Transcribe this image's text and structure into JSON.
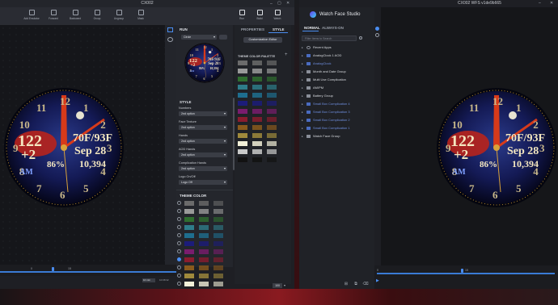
{
  "left_window": {
    "title": "CX002",
    "toolbar": [
      {
        "label": "Add Emulator",
        "icon": "emulator-icon"
      },
      {
        "label": "Forward",
        "icon": "forward-icon"
      },
      {
        "label": "Backward",
        "icon": "backward-icon"
      },
      {
        "label": "Group",
        "icon": "group-icon"
      },
      {
        "label": "Ungroup",
        "icon": "ungroup-icon"
      },
      {
        "label": "Mask",
        "icon": "mask-icon"
      }
    ],
    "toolbar_right": [
      {
        "label": "Run",
        "icon": "run-icon"
      },
      {
        "label": "Build",
        "icon": "build-icon"
      },
      {
        "label": "Watch",
        "icon": "watch-icon"
      }
    ],
    "run_panel": {
      "header": "RUN",
      "shape_value": "Circle",
      "style_header": "STYLE",
      "style_fields": [
        {
          "label": "Numbers",
          "value": "2nd option"
        },
        {
          "label": "Face Texture",
          "value": "2nd option"
        },
        {
          "label": "Hands",
          "value": "2nd option"
        },
        {
          "label": "AOD Hands",
          "value": "2nd option"
        },
        {
          "label": "Complication Hands",
          "value": "2nd option"
        },
        {
          "label": "Logo On/Off",
          "value": "Logo Off"
        }
      ],
      "theme_color_header": "THEME COLOR",
      "selected_theme_index": 7
    },
    "properties_panel": {
      "tabs": [
        "PROPERTIES",
        "STYLE"
      ],
      "active_tab": "STYLE",
      "customization_button": "Customization Editor",
      "palette_header": "THEME COLOR PALETTE"
    },
    "timeline": {
      "zoom_value": "10 min",
      "time_text": "10:08:32",
      "tick_15": "15",
      "tick_0": "0"
    },
    "zoom_percent": "100"
  },
  "right_window": {
    "title": "CX002 WFS v1de9b665",
    "app_name": "Watch Face Studio",
    "tabs": [
      "NORMAL",
      "ALWAYS-ON"
    ],
    "active_tab": "NORMAL",
    "search_placeholder": "Filter Items to Search",
    "layers": [
      {
        "label": "Recent Apps",
        "color": "white",
        "indent": 0,
        "type": "clock"
      },
      {
        "label": "AnalogClock 1 AOD",
        "color": "white",
        "indent": 0,
        "type": "item"
      },
      {
        "label": "AnalogClock",
        "color": "blue",
        "indent": 0,
        "type": "item"
      },
      {
        "label": "Month and Date Group",
        "color": "white",
        "indent": 0,
        "type": "folder"
      },
      {
        "label": "Multi Use Complication",
        "color": "white",
        "indent": 0,
        "type": "folder"
      },
      {
        "label": "AM/PM",
        "color": "white",
        "indent": 0,
        "type": "folder"
      },
      {
        "label": "Battery Group",
        "color": "white",
        "indent": 0,
        "type": "folder"
      },
      {
        "label": "Small Box Complication 4",
        "color": "blue",
        "indent": 0,
        "type": "item"
      },
      {
        "label": "Small Box Complication 3",
        "color": "blue",
        "indent": 0,
        "type": "item"
      },
      {
        "label": "Small Box Complication 2",
        "color": "blue",
        "indent": 0,
        "type": "item"
      },
      {
        "label": "Small Box Complication 1",
        "color": "blue",
        "indent": 0,
        "type": "item"
      },
      {
        "label": "Watch Face Group",
        "color": "white",
        "indent": 0,
        "type": "folder"
      }
    ],
    "timeline": {
      "tick_0": "0",
      "tick_15": "15"
    }
  },
  "watch": {
    "steps": "122",
    "heart": "+2",
    "weather": "70F/93F",
    "date": "Sep 28",
    "step_count": "10,394",
    "ampm": "AM",
    "battery": "86%",
    "hour_numbers": [
      "12",
      "1",
      "2",
      "3",
      "4",
      "5",
      "6",
      "7",
      "8",
      "9",
      "10",
      "11"
    ]
  },
  "colors": {
    "accent": "#4a8df0",
    "blue_label": "#6f8fe0",
    "swatches": [
      "#6b6b6b",
      "#9a9a9a",
      "#2f6e2f",
      "#2e7d8a",
      "#1e6e8f",
      "#1c1c7a",
      "#7a1c6e",
      "#8a1c2e",
      "#8a5a1c",
      "#a08a3c",
      "#f2f0d8",
      "#c9c9c9",
      "#121212"
    ]
  }
}
